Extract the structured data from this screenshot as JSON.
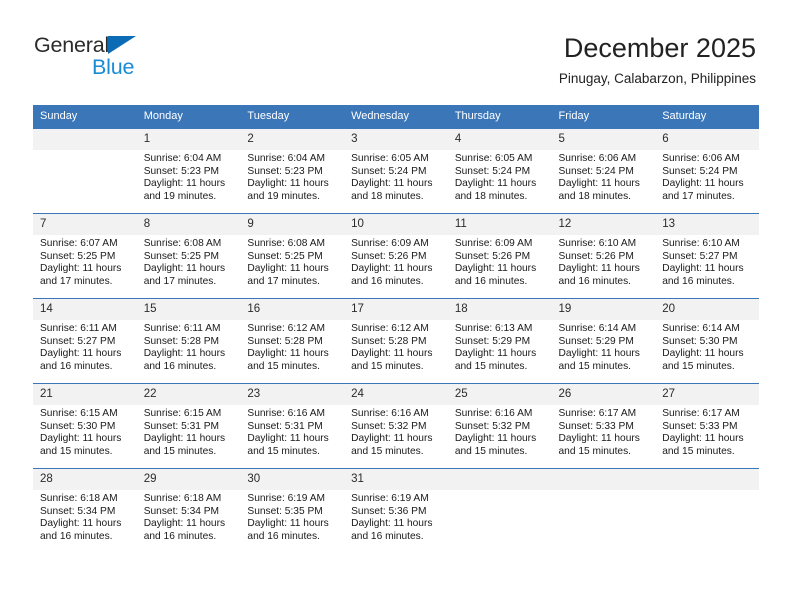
{
  "logo": {
    "word1": "General",
    "word2": "Blue",
    "triangle_color": "#0b6cb5",
    "word2_color": "#1a8bd6"
  },
  "header": {
    "title": "December 2025",
    "subtitle": "Pinugay, Calabarzon, Philippines"
  },
  "theme": {
    "header_blue": "#3a76b8",
    "daynum_bg": "#f2f2f2",
    "text": "#1a1a1a"
  },
  "calendar": {
    "weekday_headers": [
      "Sunday",
      "Monday",
      "Tuesday",
      "Wednesday",
      "Thursday",
      "Friday",
      "Saturday"
    ],
    "weeks": [
      [
        {
          "day": "",
          "sunrise": "",
          "sunset": "",
          "daylight": "",
          "daylight2": ""
        },
        {
          "day": "1",
          "sunrise": "Sunrise: 6:04 AM",
          "sunset": "Sunset: 5:23 PM",
          "daylight": "Daylight: 11 hours",
          "daylight2": "and 19 minutes."
        },
        {
          "day": "2",
          "sunrise": "Sunrise: 6:04 AM",
          "sunset": "Sunset: 5:23 PM",
          "daylight": "Daylight: 11 hours",
          "daylight2": "and 19 minutes."
        },
        {
          "day": "3",
          "sunrise": "Sunrise: 6:05 AM",
          "sunset": "Sunset: 5:24 PM",
          "daylight": "Daylight: 11 hours",
          "daylight2": "and 18 minutes."
        },
        {
          "day": "4",
          "sunrise": "Sunrise: 6:05 AM",
          "sunset": "Sunset: 5:24 PM",
          "daylight": "Daylight: 11 hours",
          "daylight2": "and 18 minutes."
        },
        {
          "day": "5",
          "sunrise": "Sunrise: 6:06 AM",
          "sunset": "Sunset: 5:24 PM",
          "daylight": "Daylight: 11 hours",
          "daylight2": "and 18 minutes."
        },
        {
          "day": "6",
          "sunrise": "Sunrise: 6:06 AM",
          "sunset": "Sunset: 5:24 PM",
          "daylight": "Daylight: 11 hours",
          "daylight2": "and 17 minutes."
        }
      ],
      [
        {
          "day": "7",
          "sunrise": "Sunrise: 6:07 AM",
          "sunset": "Sunset: 5:25 PM",
          "daylight": "Daylight: 11 hours",
          "daylight2": "and 17 minutes."
        },
        {
          "day": "8",
          "sunrise": "Sunrise: 6:08 AM",
          "sunset": "Sunset: 5:25 PM",
          "daylight": "Daylight: 11 hours",
          "daylight2": "and 17 minutes."
        },
        {
          "day": "9",
          "sunrise": "Sunrise: 6:08 AM",
          "sunset": "Sunset: 5:25 PM",
          "daylight": "Daylight: 11 hours",
          "daylight2": "and 17 minutes."
        },
        {
          "day": "10",
          "sunrise": "Sunrise: 6:09 AM",
          "sunset": "Sunset: 5:26 PM",
          "daylight": "Daylight: 11 hours",
          "daylight2": "and 16 minutes."
        },
        {
          "day": "11",
          "sunrise": "Sunrise: 6:09 AM",
          "sunset": "Sunset: 5:26 PM",
          "daylight": "Daylight: 11 hours",
          "daylight2": "and 16 minutes."
        },
        {
          "day": "12",
          "sunrise": "Sunrise: 6:10 AM",
          "sunset": "Sunset: 5:26 PM",
          "daylight": "Daylight: 11 hours",
          "daylight2": "and 16 minutes."
        },
        {
          "day": "13",
          "sunrise": "Sunrise: 6:10 AM",
          "sunset": "Sunset: 5:27 PM",
          "daylight": "Daylight: 11 hours",
          "daylight2": "and 16 minutes."
        }
      ],
      [
        {
          "day": "14",
          "sunrise": "Sunrise: 6:11 AM",
          "sunset": "Sunset: 5:27 PM",
          "daylight": "Daylight: 11 hours",
          "daylight2": "and 16 minutes."
        },
        {
          "day": "15",
          "sunrise": "Sunrise: 6:11 AM",
          "sunset": "Sunset: 5:28 PM",
          "daylight": "Daylight: 11 hours",
          "daylight2": "and 16 minutes."
        },
        {
          "day": "16",
          "sunrise": "Sunrise: 6:12 AM",
          "sunset": "Sunset: 5:28 PM",
          "daylight": "Daylight: 11 hours",
          "daylight2": "and 15 minutes."
        },
        {
          "day": "17",
          "sunrise": "Sunrise: 6:12 AM",
          "sunset": "Sunset: 5:28 PM",
          "daylight": "Daylight: 11 hours",
          "daylight2": "and 15 minutes."
        },
        {
          "day": "18",
          "sunrise": "Sunrise: 6:13 AM",
          "sunset": "Sunset: 5:29 PM",
          "daylight": "Daylight: 11 hours",
          "daylight2": "and 15 minutes."
        },
        {
          "day": "19",
          "sunrise": "Sunrise: 6:14 AM",
          "sunset": "Sunset: 5:29 PM",
          "daylight": "Daylight: 11 hours",
          "daylight2": "and 15 minutes."
        },
        {
          "day": "20",
          "sunrise": "Sunrise: 6:14 AM",
          "sunset": "Sunset: 5:30 PM",
          "daylight": "Daylight: 11 hours",
          "daylight2": "and 15 minutes."
        }
      ],
      [
        {
          "day": "21",
          "sunrise": "Sunrise: 6:15 AM",
          "sunset": "Sunset: 5:30 PM",
          "daylight": "Daylight: 11 hours",
          "daylight2": "and 15 minutes."
        },
        {
          "day": "22",
          "sunrise": "Sunrise: 6:15 AM",
          "sunset": "Sunset: 5:31 PM",
          "daylight": "Daylight: 11 hours",
          "daylight2": "and 15 minutes."
        },
        {
          "day": "23",
          "sunrise": "Sunrise: 6:16 AM",
          "sunset": "Sunset: 5:31 PM",
          "daylight": "Daylight: 11 hours",
          "daylight2": "and 15 minutes."
        },
        {
          "day": "24",
          "sunrise": "Sunrise: 6:16 AM",
          "sunset": "Sunset: 5:32 PM",
          "daylight": "Daylight: 11 hours",
          "daylight2": "and 15 minutes."
        },
        {
          "day": "25",
          "sunrise": "Sunrise: 6:16 AM",
          "sunset": "Sunset: 5:32 PM",
          "daylight": "Daylight: 11 hours",
          "daylight2": "and 15 minutes."
        },
        {
          "day": "26",
          "sunrise": "Sunrise: 6:17 AM",
          "sunset": "Sunset: 5:33 PM",
          "daylight": "Daylight: 11 hours",
          "daylight2": "and 15 minutes."
        },
        {
          "day": "27",
          "sunrise": "Sunrise: 6:17 AM",
          "sunset": "Sunset: 5:33 PM",
          "daylight": "Daylight: 11 hours",
          "daylight2": "and 15 minutes."
        }
      ],
      [
        {
          "day": "28",
          "sunrise": "Sunrise: 6:18 AM",
          "sunset": "Sunset: 5:34 PM",
          "daylight": "Daylight: 11 hours",
          "daylight2": "and 16 minutes."
        },
        {
          "day": "29",
          "sunrise": "Sunrise: 6:18 AM",
          "sunset": "Sunset: 5:34 PM",
          "daylight": "Daylight: 11 hours",
          "daylight2": "and 16 minutes."
        },
        {
          "day": "30",
          "sunrise": "Sunrise: 6:19 AM",
          "sunset": "Sunset: 5:35 PM",
          "daylight": "Daylight: 11 hours",
          "daylight2": "and 16 minutes."
        },
        {
          "day": "31",
          "sunrise": "Sunrise: 6:19 AM",
          "sunset": "Sunset: 5:36 PM",
          "daylight": "Daylight: 11 hours",
          "daylight2": "and 16 minutes."
        },
        {
          "day": "",
          "sunrise": "",
          "sunset": "",
          "daylight": "",
          "daylight2": ""
        },
        {
          "day": "",
          "sunrise": "",
          "sunset": "",
          "daylight": "",
          "daylight2": ""
        },
        {
          "day": "",
          "sunrise": "",
          "sunset": "",
          "daylight": "",
          "daylight2": ""
        }
      ]
    ]
  }
}
